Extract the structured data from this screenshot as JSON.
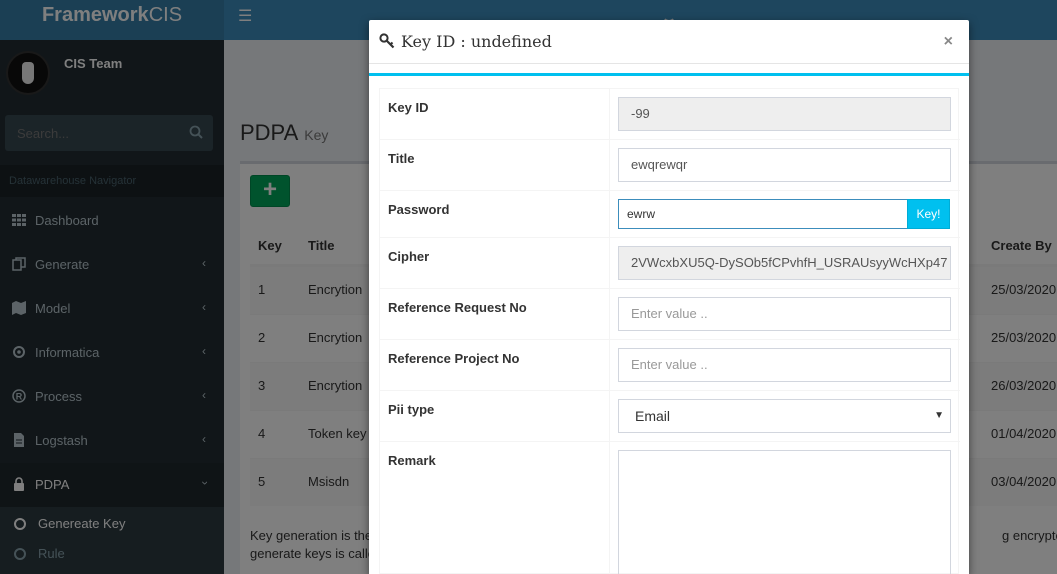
{
  "app": {
    "logo_prefix": "Framework",
    "logo_suffix": "CIS"
  },
  "user": {
    "name": "CIS Team"
  },
  "sidebar": {
    "search_placeholder": "Search...",
    "header": "Datawarehouse Navigator",
    "items": [
      {
        "label": "Dashboard",
        "icon": "grid-icon",
        "chevron": false
      },
      {
        "label": "Generate",
        "icon": "copy-icon",
        "chevron": true
      },
      {
        "label": "Model",
        "icon": "map-icon",
        "chevron": true
      },
      {
        "label": "Informatica",
        "icon": "gear-icon",
        "chevron": true
      },
      {
        "label": "Process",
        "icon": "registered-icon",
        "chevron": true
      },
      {
        "label": "Logstash",
        "icon": "file-icon",
        "chevron": true
      },
      {
        "label": "PDPA",
        "icon": "lock-icon",
        "chevron": true
      }
    ],
    "submenu": [
      {
        "label": "Genereate Key"
      },
      {
        "label": "Rule"
      }
    ]
  },
  "page": {
    "title": "PDPA",
    "subtitle": "Key"
  },
  "table": {
    "headers": {
      "key": "Key",
      "title": "Title",
      "create_by": "Create By"
    },
    "rows": [
      {
        "key": "1",
        "title": "Encrytion",
        "create_by": "25/03/2020"
      },
      {
        "key": "2",
        "title": "Encrytion",
        "create_by": "25/03/2020"
      },
      {
        "key": "3",
        "title": "Encrytion",
        "create_by": "26/03/2020"
      },
      {
        "key": "4",
        "title": "Token key",
        "create_by": "01/04/2020"
      },
      {
        "key": "5",
        "title": "Msisdn",
        "create_by": "03/04/2020"
      }
    ],
    "footer_line1": "Key generation is the",
    "footer_line1_end": "g encrypted/dec",
    "footer_line2": "generate keys is calle"
  },
  "modal": {
    "title": "Key ID : undefined",
    "close": "×",
    "fields": {
      "key_id": {
        "label": "Key ID",
        "value": "-99"
      },
      "title": {
        "label": "Title",
        "value": "ewqrewqr"
      },
      "password": {
        "label": "Password",
        "value": "ewrw",
        "button": "Key!"
      },
      "cipher": {
        "label": "Cipher",
        "value": "2VWcxbXU5Q-DySOb5fCPvhfH_USRAUsyyWcHXp47"
      },
      "ref_request": {
        "label": "Reference Request No",
        "placeholder": "Enter value .."
      },
      "ref_project": {
        "label": "Reference Project No",
        "placeholder": "Enter value .."
      },
      "pii_type": {
        "label": "Pii type",
        "value": "Email"
      },
      "remark": {
        "label": "Remark",
        "value": ""
      }
    }
  },
  "colors": {
    "accent": "#00c0ef",
    "header": "#3c8dbc",
    "sidebar": "#222d32",
    "success": "#00a65a"
  }
}
